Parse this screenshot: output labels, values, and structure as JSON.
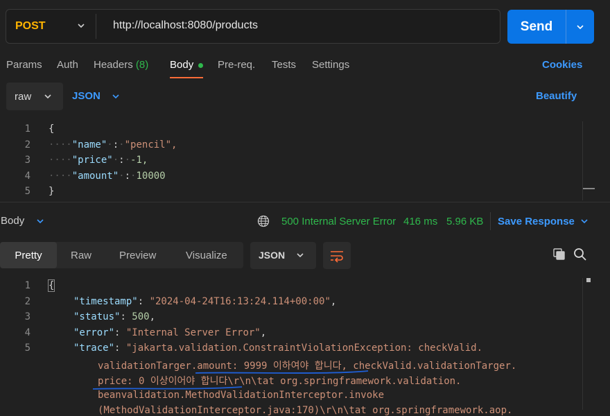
{
  "request": {
    "method": "POST",
    "url": "http://localhost:8080/products",
    "send_label": "Send"
  },
  "tabs": {
    "params": "Params",
    "auth": "Auth",
    "headers": "Headers",
    "headers_count": "(8)",
    "body": "Body",
    "prereq": "Pre-req.",
    "tests": "Tests",
    "settings": "Settings",
    "cookies": "Cookies"
  },
  "body_options": {
    "mode": "raw",
    "language": "JSON",
    "beautify": "Beautify"
  },
  "request_body": {
    "line_numbers": [
      "1",
      "2",
      "3",
      "4",
      "5"
    ],
    "open": "{",
    "close": "}",
    "fields": [
      {
        "key": "\"name\"",
        "value": "\"pencil\","
      },
      {
        "key": "\"price\"",
        "value": "-1,"
      },
      {
        "key": "\"amount\"",
        "value": "10000"
      }
    ]
  },
  "response_bar": {
    "label": "Body",
    "status": "500 Internal Server Error",
    "time": "416 ms",
    "size": "5.96 KB",
    "save": "Save Response"
  },
  "view_tabs": {
    "pretty": "Pretty",
    "raw": "Raw",
    "preview": "Preview",
    "visualize": "Visualize",
    "format": "JSON"
  },
  "response_body": {
    "line_numbers": [
      "1",
      "2",
      "3",
      "4",
      "5"
    ],
    "open": "{",
    "timestamp_key": "\"timestamp\"",
    "timestamp_val": "\"2024-04-24T16:13:24.114+00:00\"",
    "status_key": "\"status\"",
    "status_val": "500",
    "error_key": "\"error\"",
    "error_val": "\"Internal Server Error\"",
    "trace_key": "\"trace\"",
    "trace_lines": [
      "\"jakarta.validation.ConstraintViolationException: checkValid.",
      "validationTarger.amount: 9999 이하여야 합니다, checkValid.validationTarger.",
      "price: 0 이상이어야 합니다\\r\\n\\tat org.springframework.validation.",
      "beanvalidation.MethodValidationInterceptor.invoke",
      "(MethodValidationInterceptor.java:170)\\r\\n\\tat org.springframework.aop."
    ]
  },
  "colors": {
    "accent_blue": "#0a75e6",
    "method_orange": "#ffb400",
    "status_green": "#2fb84c",
    "tab_underline": "#ff6c37",
    "annotation_blue": "#1f5fd6"
  }
}
